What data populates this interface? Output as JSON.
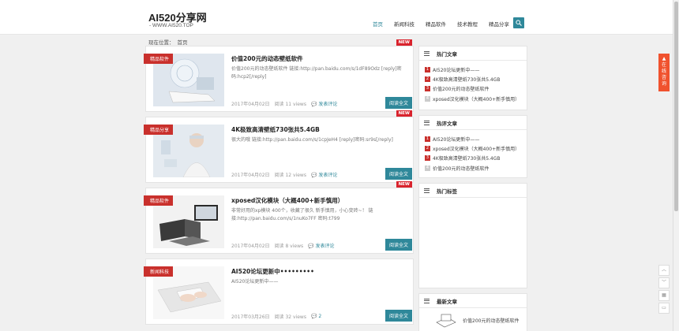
{
  "site": {
    "title": "AI520分享网",
    "subtitle": "- WWW.AI520.TOP"
  },
  "nav": [
    "首页",
    "新闻科技",
    "精品软件",
    "技术教程",
    "精品分享"
  ],
  "breadcrumb": {
    "label": "现在位置：",
    "home": "首页"
  },
  "posts": [
    {
      "category": "精品软件",
      "new": "NEW",
      "title": "价值200元的动态壁纸软件",
      "excerpt": "价值200元的动态壁纸软件  链接:http://pan.baidu.com/s/1dF89Odz [reply]密码:hcp2[/reply]",
      "date": "2017年04月02日",
      "views": "阅读 11 views",
      "comment": "发表评论",
      "read_more": "阅读全文"
    },
    {
      "category": "精品分享",
      "new": "NEW",
      "title": "4K极致高清壁纸730张共5.4GB",
      "excerpt": "很大的哦    链接:http://pan.baidu.com/s/1cpJeH4 [reply]密码:sr9s[/reply]",
      "date": "2017年04月02日",
      "views": "阅读 12 views",
      "comment": "发表评论",
      "read_more": "阅读全文"
    },
    {
      "category": "精品软件",
      "new": "NEW",
      "title": "xposed汉化模块（大概400+新手慎用）",
      "excerpt": "非常好用的xp模块 400个，收藏了很久 新手慎用，小心变砖~！   链接:http://pan.baidu.com/s/1nuKo7FF 密码:t799",
      "date": "2017年04月02日",
      "views": "阅读 8 views",
      "comment": "发表评论",
      "read_more": "阅读全文"
    },
    {
      "category": "新闻科技",
      "new": "",
      "title": "AI520论坛更新中•••••••••",
      "excerpt": "AI520论坛更新中——",
      "date": "2017年03月26日",
      "views": "阅读 32 views",
      "comment": "2",
      "read_more": "阅读全文"
    }
  ],
  "widgets": {
    "hot": {
      "title": "热门文章",
      "items": [
        "AI520论坛更新中——",
        "4K极致高清壁纸730张共5.4GB",
        "价值200元的动态壁纸软件",
        "xposed汉化模块（大概400+新手慎用）"
      ]
    },
    "recommended": {
      "title": "热评文章",
      "items": [
        "AI520论坛更新中——",
        "xposed汉化模块（大概400+新手慎用）",
        "4K极致高清壁纸730张共5.4GB",
        "价值200元的动态壁纸软件"
      ]
    },
    "tags": {
      "title": "热门标签"
    },
    "latest": {
      "title": "最新文章",
      "items": [
        "价值200元的动态壁纸软件"
      ]
    }
  },
  "float": {
    "consult": "在线咨询"
  },
  "colors": {
    "accent": "#2f889a",
    "tag": "#c9302c",
    "new": "#d9232d",
    "consult": "#f0522e"
  }
}
